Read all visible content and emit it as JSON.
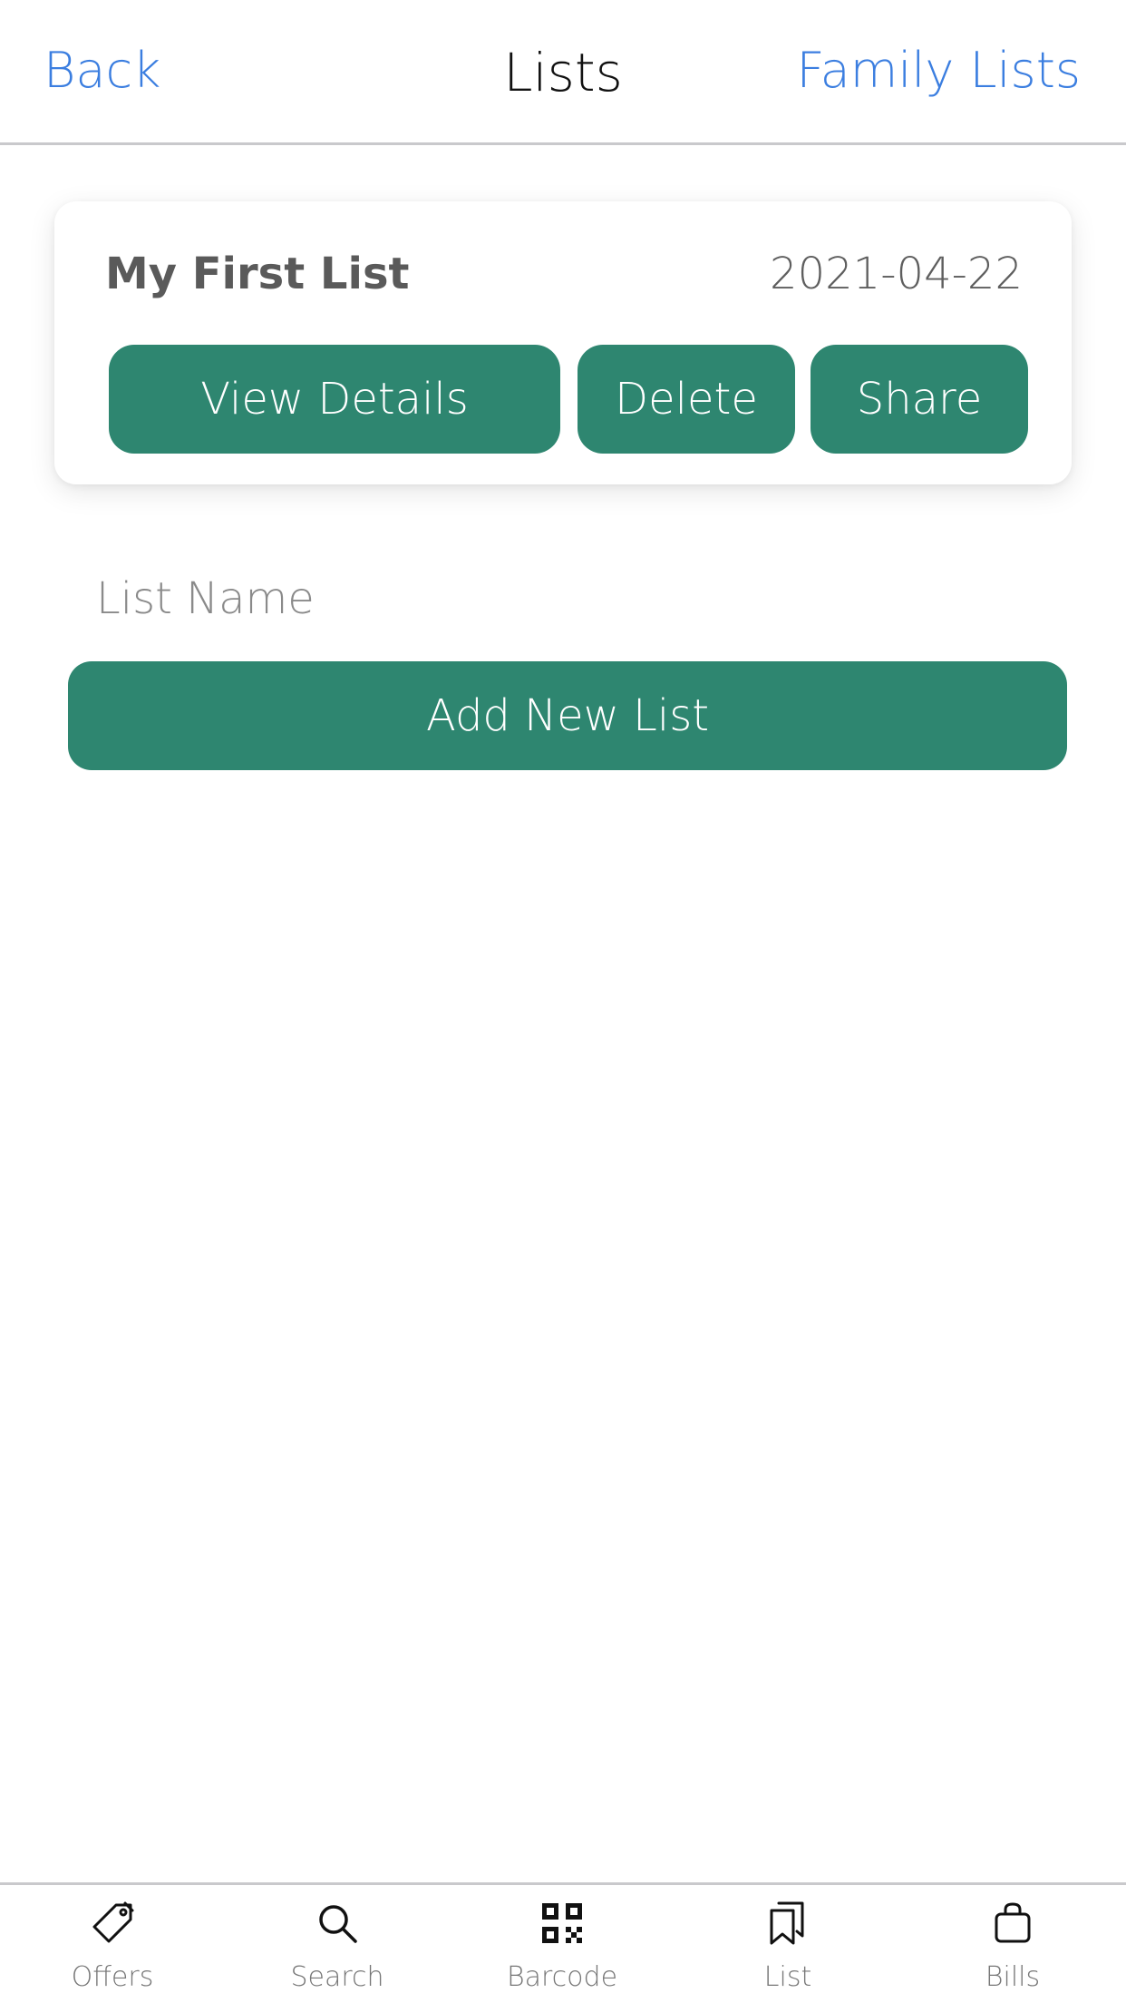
{
  "header": {
    "back_label": "Back",
    "title": "Lists",
    "right_label": "Family Lists"
  },
  "lists": [
    {
      "name": "My First List",
      "date": "2021-04-22",
      "actions": {
        "view": "View Details",
        "delete": "Delete",
        "share": "Share"
      }
    }
  ],
  "new_list": {
    "placeholder": "List Name",
    "value": "",
    "add_label": "Add New List"
  },
  "tabbar": {
    "items": [
      {
        "label": "Offers",
        "icon": "tag-icon"
      },
      {
        "label": "Search",
        "icon": "search-icon"
      },
      {
        "label": "Barcode",
        "icon": "qr-code-icon"
      },
      {
        "label": "List",
        "icon": "bookmarks-icon"
      },
      {
        "label": "Bills",
        "icon": "shopping-bag-icon"
      }
    ]
  },
  "colors": {
    "accent_green": "#2e8670",
    "link_blue": "#3b7ee0"
  }
}
